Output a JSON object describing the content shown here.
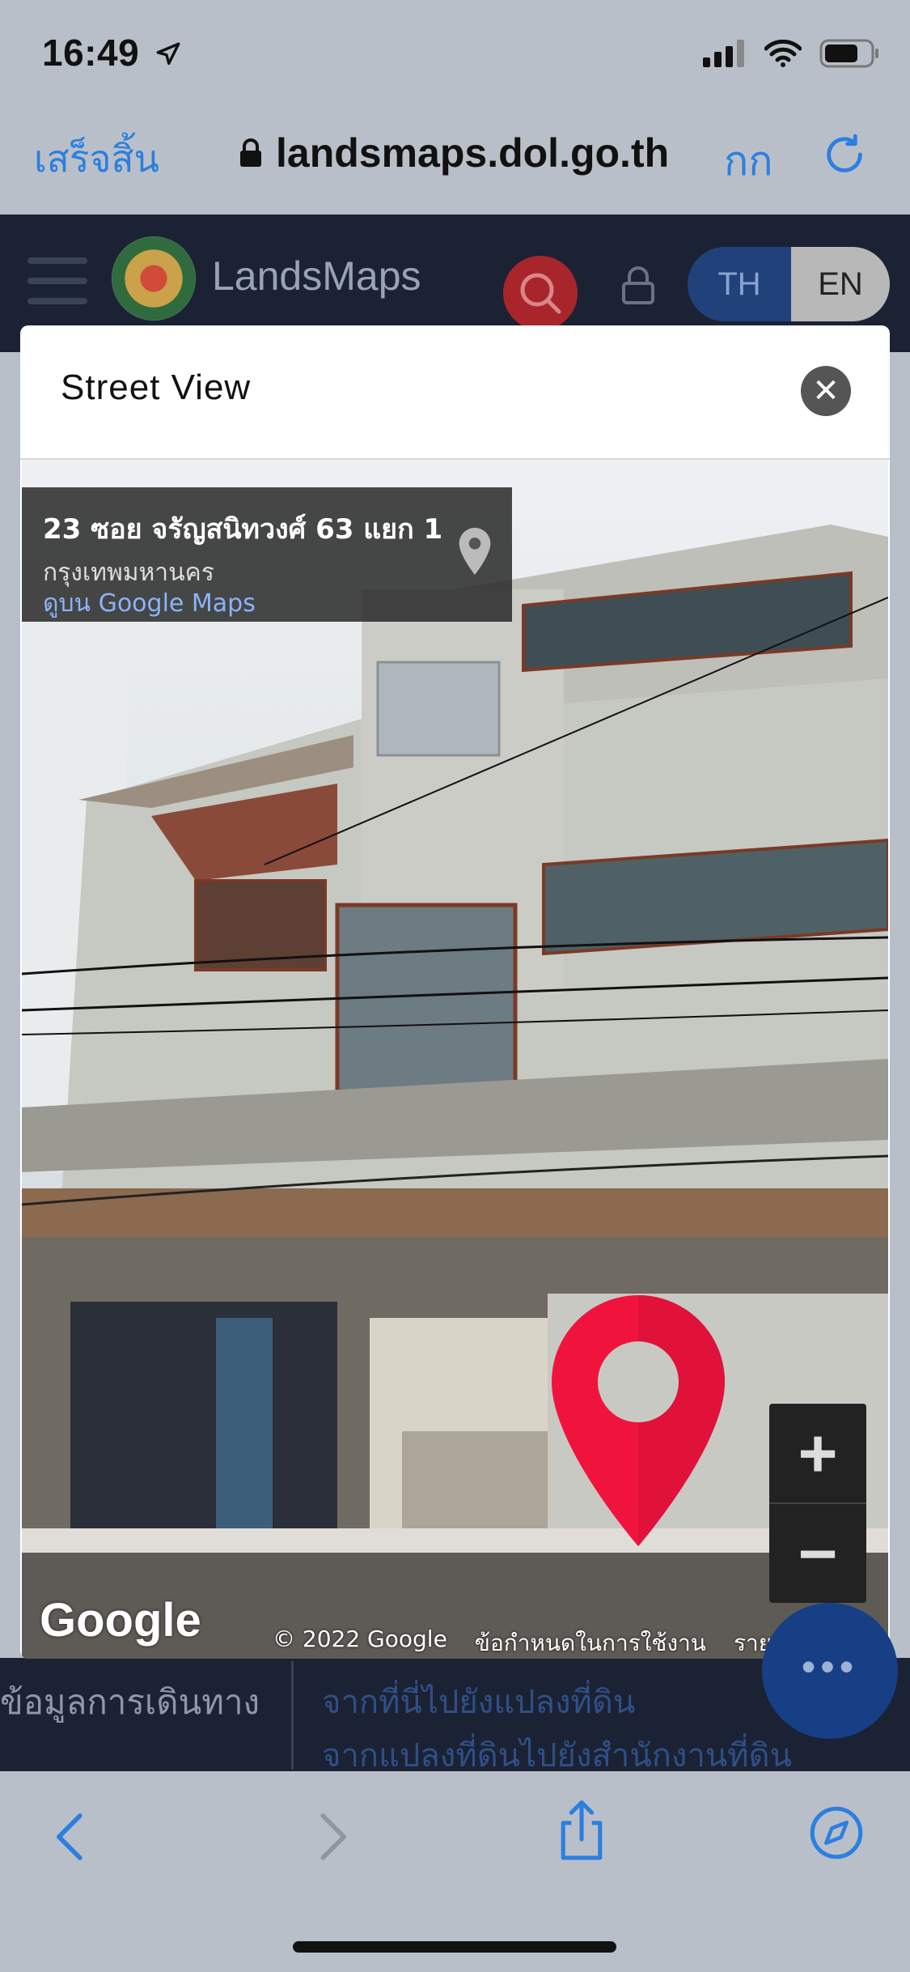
{
  "status": {
    "time": "16:49"
  },
  "browser": {
    "done_label": "เสร็จสิ้น",
    "url": "landsmaps.dol.go.th",
    "text_size_label": "กก"
  },
  "site": {
    "brand": "LandsMaps",
    "lang_th": "TH",
    "lang_en": "EN"
  },
  "modal": {
    "title": "Street View",
    "card": {
      "address": "23 ซอย จรัญสนิทวงศ์ 63 แยก 1",
      "city": "กรุงเทพมหานคร",
      "maps_link": "ดูบน Google Maps"
    },
    "google_logo": "Google",
    "attribution": {
      "copyright": "© 2022 Google",
      "terms": "ข้อกำหนดในการใช้งาน",
      "report": "รายงานปัญหา"
    }
  },
  "underlying": {
    "left_label": "ข้อมูลการเดินทาง",
    "route_1": "จากที่นี่ไปยังแปลงที่ดิน",
    "route_2": "จากแปลงที่ดินไปยังสำนักงานที่ดิน"
  },
  "colors": {
    "accent": "#2b7fe0",
    "header_bg": "#1b2233",
    "marker": "#f0143c",
    "fab": "#163f86"
  }
}
